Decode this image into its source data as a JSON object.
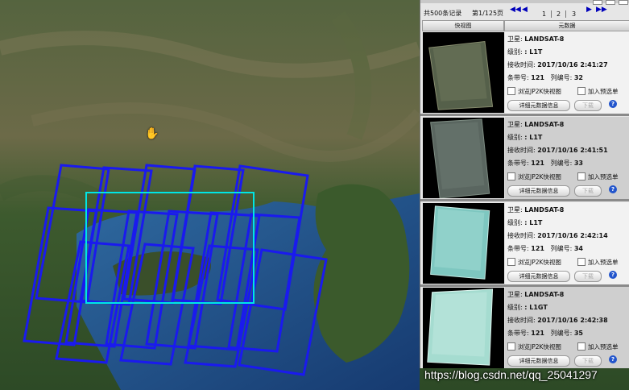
{
  "map": {
    "cursor_icon": "hand-cursor-icon"
  },
  "panel": {
    "total": "共500条记录",
    "page_info": "第1/125页",
    "nav": {
      "first": "◀◀",
      "prev": "◀",
      "next": "▶",
      "last": "▶▶"
    },
    "pages": [
      "1",
      "2",
      "3"
    ],
    "columns": {
      "thumb": "快视图",
      "meta": "元数据"
    },
    "labels": {
      "satellite": "卫星:",
      "level": "级别:",
      "time": "接收时间:",
      "row": "条带号:",
      "col": "列编号:"
    },
    "records": [
      {
        "satellite": "LANDSAT-8",
        "level": ": L1T",
        "time": "2017/10/16 2:41:27",
        "row": "121",
        "col": "32",
        "jp2": "浏览JP2K快视图",
        "cart": "加入预选单",
        "detail": "详细元数据信息",
        "download": "下载"
      },
      {
        "satellite": "LANDSAT-8",
        "level": ": L1T",
        "time": "2017/10/16 2:41:51",
        "row": "121",
        "col": "33",
        "jp2": "浏览JP2K快视图",
        "cart": "加入预选单",
        "detail": "详细元数据信息",
        "download": "下载"
      },
      {
        "satellite": "LANDSAT-8",
        "level": ": L1T",
        "time": "2017/10/16 2:42:14",
        "row": "121",
        "col": "34",
        "jp2": "浏览JP2K快视图",
        "cart": "加入预选单",
        "detail": "详细元数据信息",
        "download": "下载"
      },
      {
        "satellite": "LANDSAT-8",
        "level": ": L1GT",
        "time": "2017/10/16 2:42:38",
        "row": "121",
        "col": "35",
        "jp2": "浏览JP2K快视图",
        "cart": "加入预选单",
        "detail": "详细元数据信息",
        "download": "下载"
      }
    ]
  },
  "watermark": "https://blog.csdn.net/qq_25041297",
  "colors": {
    "footprint": "#1a1aee",
    "selection": "#00e5e5",
    "sea": "#1f4f8a",
    "help": "#2255cc"
  }
}
